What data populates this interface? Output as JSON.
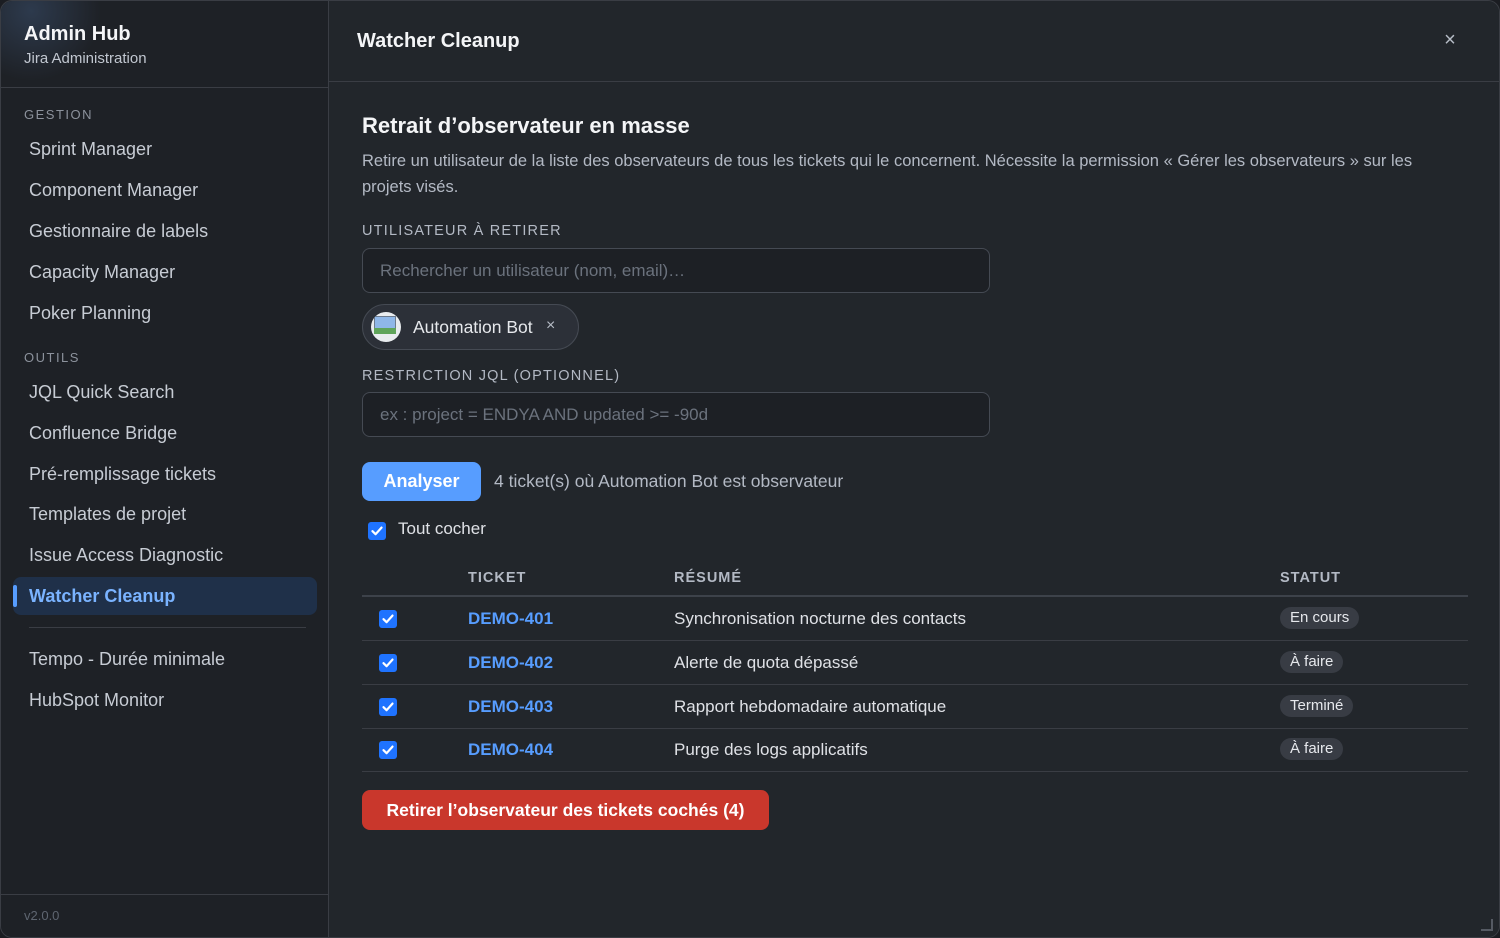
{
  "sidebar": {
    "title": "Admin Hub",
    "subtitle": "Jira Administration",
    "sections": [
      {
        "label": "GESTION"
      },
      {
        "label": "OUTILS"
      }
    ],
    "items": [
      {
        "label": "Sprint Manager"
      },
      {
        "label": "Component Manager"
      },
      {
        "label": "Gestionnaire de labels"
      },
      {
        "label": "Capacity Manager"
      },
      {
        "label": "Poker Planning"
      },
      {
        "label": "JQL Quick Search"
      },
      {
        "label": "Confluence Bridge"
      },
      {
        "label": "Pré-remplissage tickets"
      },
      {
        "label": "Templates de projet"
      },
      {
        "label": "Issue Access Diagnostic"
      },
      {
        "label": "Watcher Cleanup",
        "active": true
      },
      {
        "label": "Tempo - Durée minimale"
      },
      {
        "label": "HubSpot Monitor"
      }
    ],
    "version": "v2.0.0"
  },
  "header": {
    "title": "Watcher Cleanup",
    "close_icon": "×"
  },
  "main": {
    "heading": "Retrait d’observateur en masse",
    "description": "Retire un utilisateur de la liste des observateurs de tous les tickets qui le concernent. Nécessite la permission « Gérer les observateurs » sur les projets visés.",
    "user_field": {
      "label": "UTILISATEUR À RETIRER",
      "placeholder": "Rechercher un utilisateur (nom, email)…",
      "value": ""
    },
    "selected_user": {
      "name": "Automation Bot",
      "remove_icon": "×"
    },
    "jql_field": {
      "label": "RESTRICTION JQL (OPTIONNEL)",
      "placeholder": "ex : project = ENDYA AND updated >= -90d",
      "value": ""
    },
    "analyze_button": "Analyser",
    "result_text": "4 ticket(s) où Automation Bot est observateur",
    "select_all_label": "Tout cocher",
    "select_all_checked": true,
    "table": {
      "columns": [
        "TICKET",
        "RÉSUMÉ",
        "STATUT"
      ],
      "rows": [
        {
          "checked": true,
          "key": "DEMO-401",
          "summary": "Synchronisation nocturne des contacts",
          "status": "En cours"
        },
        {
          "checked": true,
          "key": "DEMO-402",
          "summary": "Alerte de quota dépassé",
          "status": "À faire"
        },
        {
          "checked": true,
          "key": "DEMO-403",
          "summary": "Rapport hebdomadaire automatique",
          "status": "Terminé"
        },
        {
          "checked": true,
          "key": "DEMO-404",
          "summary": "Purge des logs applicatifs",
          "status": "À faire"
        }
      ]
    },
    "remove_button": "Retirer l’observateur des tickets cochés (4)"
  },
  "colors": {
    "accent": "#579dff",
    "danger": "#c9372c",
    "checkbox": "#1f73ff",
    "background": "#22262b",
    "sidebar": "#1e2126"
  }
}
